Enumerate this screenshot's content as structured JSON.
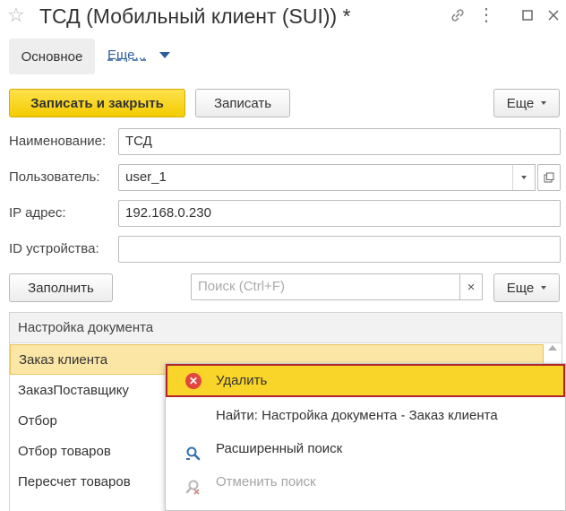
{
  "window": {
    "title": "ТСД (Мобильный клиент (SUI)) *",
    "icons": [
      "star-icon",
      "link-icon",
      "more-icon",
      "maximize-icon",
      "close-icon"
    ]
  },
  "nav": {
    "main_tab": "Основное",
    "more_link": "Еще..."
  },
  "toolbar": {
    "save_close_label": "Записать и закрыть",
    "save_label": "Записать",
    "more_label": "Еще"
  },
  "form": {
    "name_label": "Наименование:",
    "name_value": "ТСД",
    "user_label": "Пользователь:",
    "user_value": "user_1",
    "ip_label": "IP адрес:",
    "ip_value": "192.168.0.230",
    "device_label": "ID устройства:",
    "device_value": ""
  },
  "table_toolbar": {
    "fill_label": "Заполнить",
    "search_placeholder": "Поиск (Ctrl+F)",
    "more_label": "Еще"
  },
  "table": {
    "header": "Настройка документа",
    "rows": [
      "Заказ клиента",
      "ЗаказПоставщику",
      "Отбор",
      "Отбор товаров",
      "Пересчет товаров"
    ],
    "selected_index": 0
  },
  "context_menu": {
    "items": [
      {
        "label": "Удалить",
        "icon": "delete-icon",
        "highlighted": true,
        "enabled": true
      },
      {
        "label": "Найти: Настройка документа - Заказ клиента",
        "icon": "",
        "highlighted": false,
        "enabled": true
      },
      {
        "label": "Расширенный поиск",
        "icon": "advanced-search-icon",
        "highlighted": false,
        "enabled": true
      },
      {
        "label": "Отменить поиск",
        "icon": "cancel-search-icon",
        "highlighted": false,
        "enabled": false
      }
    ]
  },
  "colors": {
    "primary_button": "#f5d000",
    "selected_row": "#fbe6a5",
    "menu_highlight": "#f9d429",
    "menu_highlight_border": "#b2262b",
    "link": "#2e5e9c"
  }
}
